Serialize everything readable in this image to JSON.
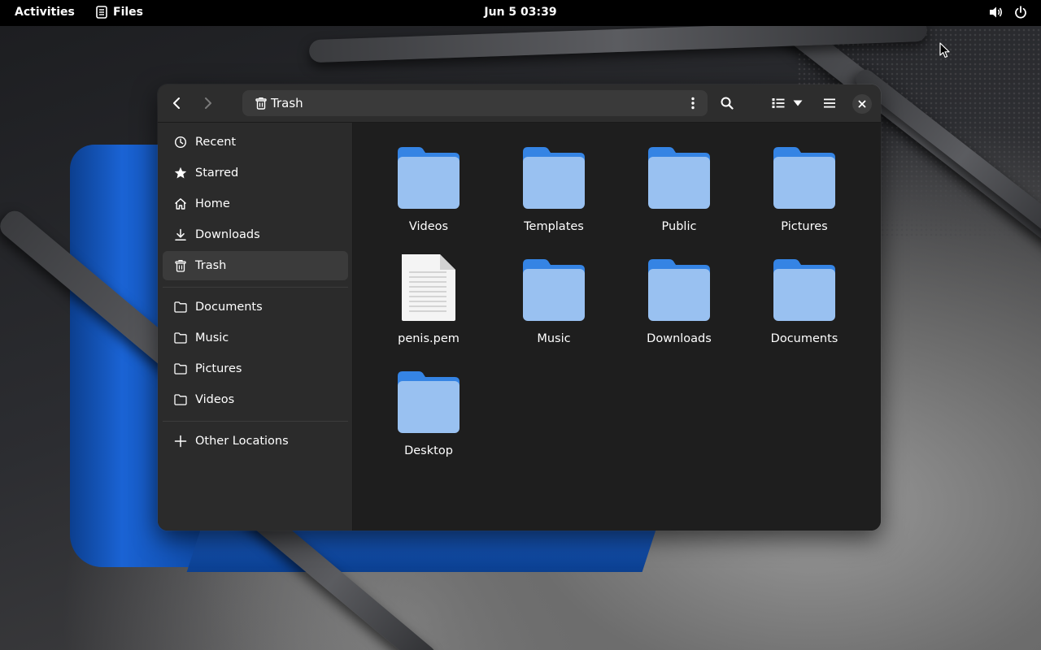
{
  "topbar": {
    "activities": "Activities",
    "app_name": "Files",
    "clock": "Jun 5  03:39",
    "tray_icons": [
      "volume-icon",
      "power-icon"
    ]
  },
  "window": {
    "path": {
      "label": "Trash",
      "icon": "trash-icon"
    },
    "header_buttons": [
      "back",
      "forward",
      "path-menu",
      "search",
      "list-view",
      "view-options",
      "main-menu",
      "close"
    ]
  },
  "sidebar": {
    "items": [
      {
        "label": "Recent",
        "icon": "clock-icon"
      },
      {
        "label": "Starred",
        "icon": "star-icon"
      },
      {
        "label": "Home",
        "icon": "home-icon"
      },
      {
        "label": "Downloads",
        "icon": "download-icon"
      },
      {
        "label": "Trash",
        "icon": "trash-icon",
        "active": true
      }
    ],
    "bookmarks": [
      {
        "label": "Documents",
        "icon": "folder-icon"
      },
      {
        "label": "Music",
        "icon": "folder-icon"
      },
      {
        "label": "Pictures",
        "icon": "folder-icon"
      },
      {
        "label": "Videos",
        "icon": "folder-icon"
      }
    ],
    "other": {
      "label": "Other Locations",
      "icon": "plus-icon"
    }
  },
  "files": [
    {
      "name": "Videos",
      "type": "folder"
    },
    {
      "name": "Templates",
      "type": "folder"
    },
    {
      "name": "Public",
      "type": "folder"
    },
    {
      "name": "Pictures",
      "type": "folder"
    },
    {
      "name": "penis.pem",
      "type": "document"
    },
    {
      "name": "Music",
      "type": "folder"
    },
    {
      "name": "Downloads",
      "type": "folder"
    },
    {
      "name": "Documents",
      "type": "folder"
    },
    {
      "name": "Desktop",
      "type": "folder"
    }
  ],
  "colors": {
    "folder_back": "#3584e4",
    "folder_front": "#99c1f1",
    "accent": "#3584e4",
    "window_bg": "#1e1e1e",
    "sidebar_bg": "#2b2b2b"
  }
}
